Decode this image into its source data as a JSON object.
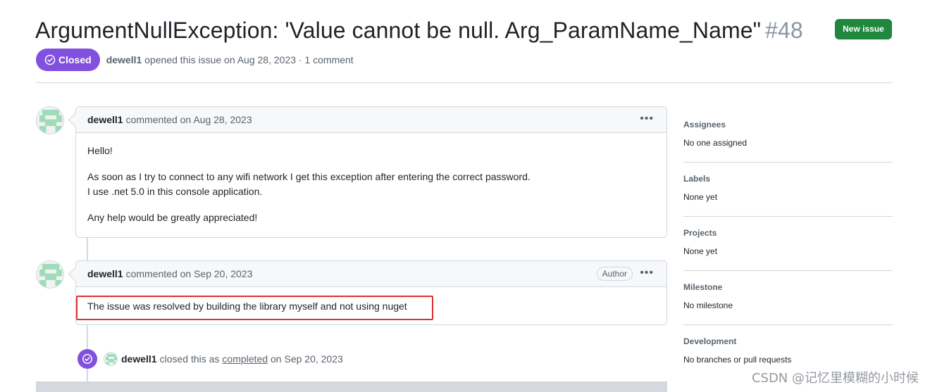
{
  "issue": {
    "title": "ArgumentNullException: 'Value cannot be null. Arg_ParamName_Name\"",
    "number": "#48",
    "state": "Closed",
    "author": "dewell1",
    "meta": "opened this issue on Aug 28, 2023 · 1 comment",
    "new_issue_label": "New issue"
  },
  "comments": [
    {
      "author": "dewell1",
      "action": "commented on Aug 28, 2023",
      "badge": "",
      "paragraphs": [
        "Hello!",
        "As soon as I try to connect to any wifi network I get this exception after entering the correct password.",
        "I use .net 5.0 in this console application.",
        "Any help would be greatly appreciated!"
      ]
    },
    {
      "author": "dewell1",
      "action": "commented on Sep 20, 2023",
      "badge": "Author",
      "paragraphs": [
        "The issue was resolved by building the library myself and not using nuget"
      ]
    }
  ],
  "event": {
    "author": "dewell1",
    "text_before": "closed this as",
    "link": "completed",
    "text_after": "on Sep 20, 2023"
  },
  "sidebar": [
    {
      "heading": "Assignees",
      "value": "No one assigned"
    },
    {
      "heading": "Labels",
      "value": "None yet"
    },
    {
      "heading": "Projects",
      "value": "None yet"
    },
    {
      "heading": "Milestone",
      "value": "No milestone"
    },
    {
      "heading": "Development",
      "value": "No branches or pull requests"
    }
  ],
  "watermark": "CSDN @记忆里模糊的小时候",
  "colors": {
    "closed_purple": "#8250df",
    "new_issue_green": "#1f883d",
    "highlight_red": "#e03030",
    "avatar_green": "#9fdcb7"
  },
  "icons": {
    "state": "check-circle-icon",
    "menu": "kebab-horizontal-icon",
    "event": "check-circle-icon",
    "avatar": "identicon"
  }
}
